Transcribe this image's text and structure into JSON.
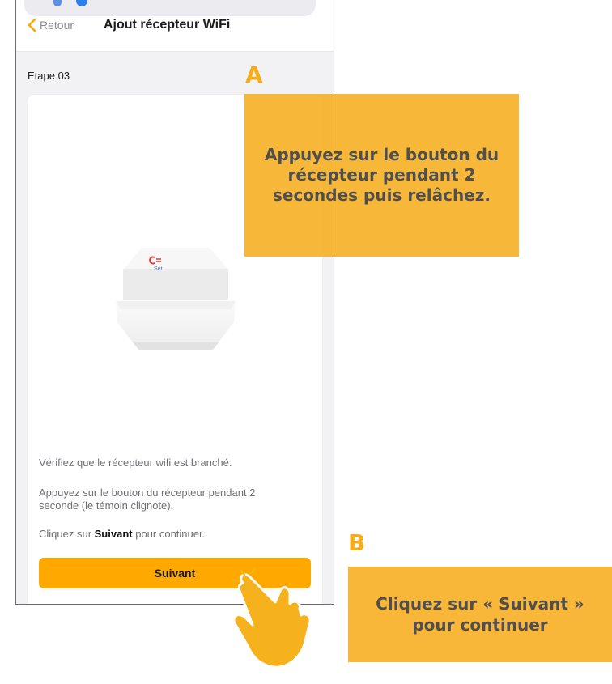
{
  "header": {
    "back_label": "Retour",
    "title": "Ajout récepteur WiFi"
  },
  "step_label": "Etape 03",
  "device": {
    "set_label": "Set"
  },
  "instructions": {
    "line1": "Vérifiez que le récepteur wifi est branché.",
    "line2": "Appuyez sur le bouton du récepteur pendant 2 seconde (le témoin clignote).",
    "line3_prefix": "Cliquez sur ",
    "line3_bold": "Suivant",
    "line3_suffix": " pour continuer."
  },
  "next_button_label": "Suivant",
  "annotations": {
    "letter_a": "A",
    "callout_a": "Appuyez sur le bouton du récepteur pendant 2 secondes puis relâchez.",
    "letter_b": "B",
    "callout_b": "Cliquez sur « Suivant » pour continuer"
  },
  "colors": {
    "accent": "#ffa800",
    "annotation": "#f6ad1a",
    "status_icon": "#2f80ed"
  }
}
